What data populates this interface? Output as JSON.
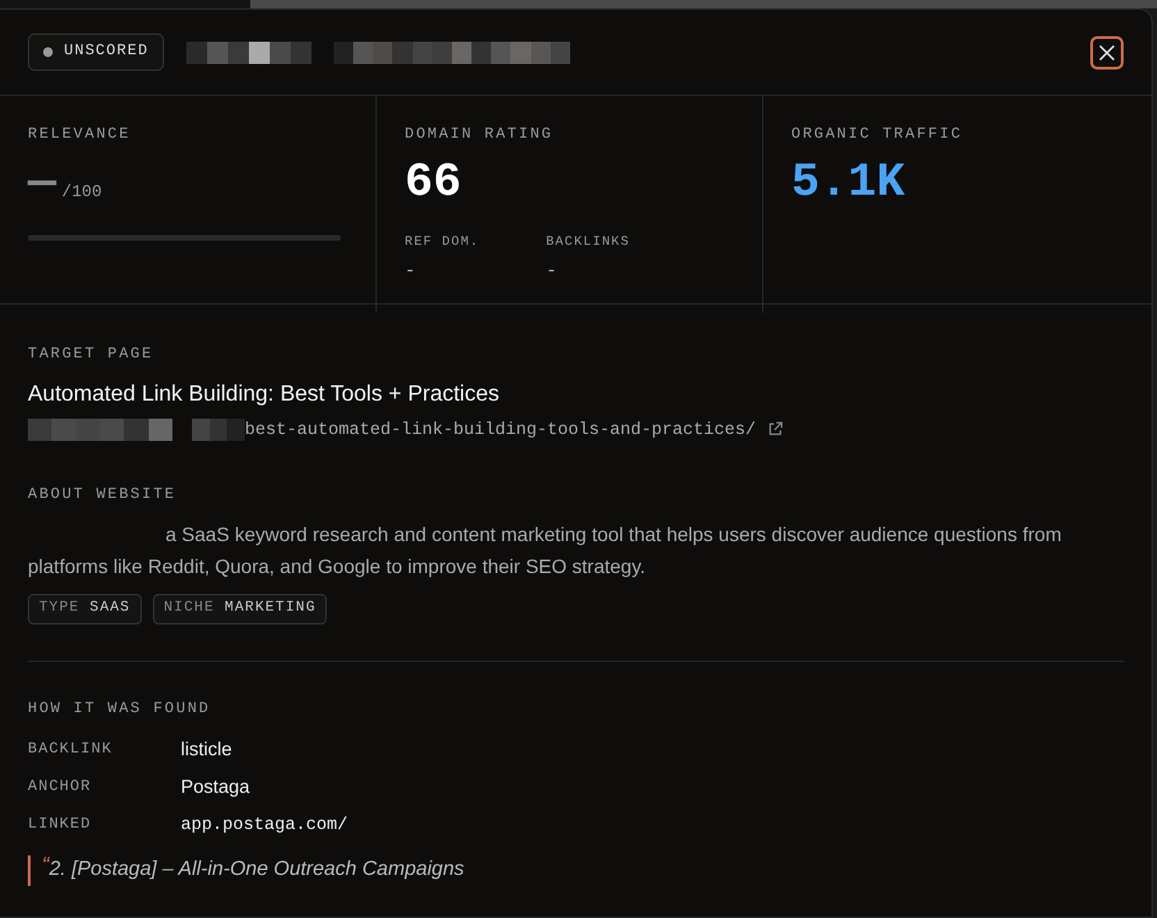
{
  "header": {
    "status_badge": {
      "label": "UNSCORED",
      "color": "#9a9a9a"
    }
  },
  "metrics": [
    {
      "kind": "score",
      "label": "RELEVANCE",
      "value": "—",
      "suffix": "/100",
      "level": 0
    },
    {
      "kind": "rating",
      "label": "DOMAIN RATING",
      "value": "66",
      "sub": [
        {
          "label": "REF DOM.",
          "value": "-"
        },
        {
          "label": "BACKLINKS",
          "value": "-"
        }
      ]
    },
    {
      "kind": "traffic",
      "label": "ORGANIC TRAFFIC",
      "value": "5.1K"
    }
  ],
  "target_page": {
    "heading": "TARGET PAGE",
    "title": "Automated Link Building: Best Tools + Practices",
    "url_path": "best-automated-link-building-tools-and-practices/"
  },
  "about_website": {
    "heading": "ABOUT WEBSITE",
    "description": "a SaaS keyword research and content marketing tool that helps users discover audience questions from platforms like Reddit, Quora, and Google to improve their SEO strategy.",
    "tags": [
      {
        "key": "TYPE",
        "value": "SAAS"
      },
      {
        "key": "NICHE",
        "value": "MARKETING"
      }
    ]
  },
  "how_found": {
    "heading": "HOW IT WAS FOUND",
    "rows": [
      {
        "label": "BACKLINK",
        "value": "listicle",
        "kind": "text"
      },
      {
        "label": "ANCHOR",
        "value": "Postaga",
        "kind": "text"
      },
      {
        "label": "LINKED",
        "value": "app.postaga.com/",
        "kind": "mono"
      }
    ],
    "quote_mark": "“",
    "quote": "2. [Postaga] – All-in-One Outreach Campaigns"
  }
}
